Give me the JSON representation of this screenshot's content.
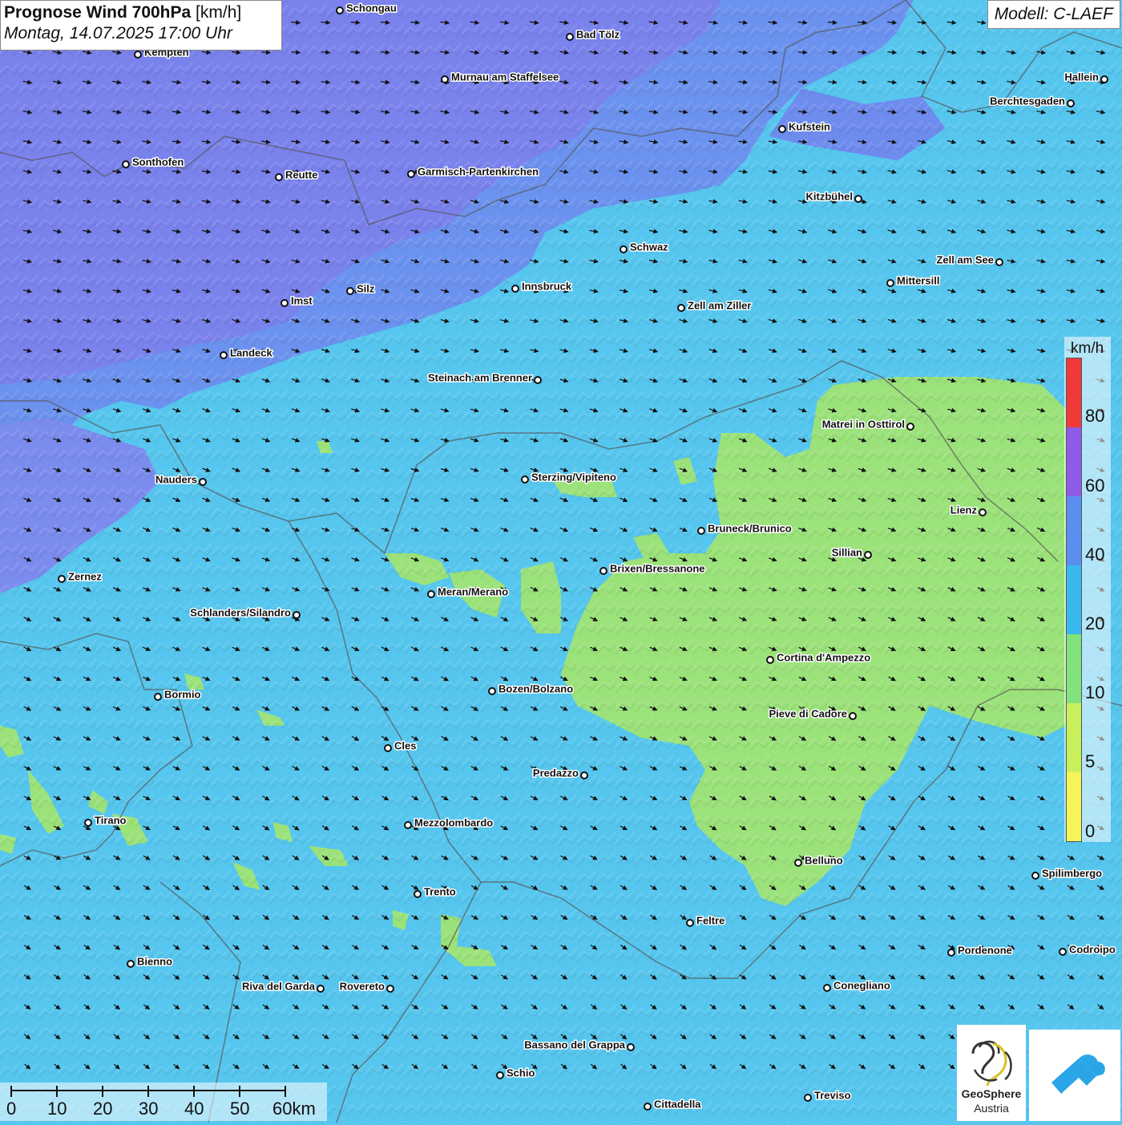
{
  "title": {
    "bold": "Prognose Wind 700hPa",
    "unit": "[km/h]",
    "datetime": "Montag, 14.07.2025 17:00 Uhr"
  },
  "model": "Modell: C-LAEF",
  "legend": {
    "unit": "km/h",
    "ticks": [
      "80",
      "60",
      "40",
      "20",
      "10",
      "5",
      "0"
    ],
    "colors": [
      "#f03a3a",
      "#8e5ce8",
      "#5a8ff0",
      "#38b8ee",
      "#82e27c",
      "#c8f05a",
      "#f5f55a"
    ]
  },
  "scalebar": {
    "labels": [
      "0",
      "10",
      "20",
      "30",
      "40",
      "50",
      "60km"
    ]
  },
  "logos": {
    "geosphere_line1": "GeoSphere",
    "geosphere_line2": "Austria"
  },
  "colors": {
    "speed_20_40": "#5a8ff0",
    "speed_40_60": "#7a82ec",
    "speed_10_20": "#56c6ee",
    "speed_5_10": "#9be27a"
  },
  "cities": [
    {
      "name": "Schongau"
    },
    {
      "name": "Bad Tölz"
    },
    {
      "name": "Kempten"
    },
    {
      "name": "Murnau am Staffelsee"
    },
    {
      "name": "Hallein"
    },
    {
      "name": "Berchtesgaden"
    },
    {
      "name": "Kufstein"
    },
    {
      "name": "Sonthofen"
    },
    {
      "name": "Reutte"
    },
    {
      "name": "Garmisch-Partenkirchen"
    },
    {
      "name": "Kitzbühel"
    },
    {
      "name": "Schwaz"
    },
    {
      "name": "Zell am See"
    },
    {
      "name": "Mittersill"
    },
    {
      "name": "Innsbruck"
    },
    {
      "name": "Silz"
    },
    {
      "name": "Imst"
    },
    {
      "name": "Zell am Ziller"
    },
    {
      "name": "Landeck"
    },
    {
      "name": "Steinach am Brenner"
    },
    {
      "name": "Matrei in Osttirol"
    },
    {
      "name": "Nauders"
    },
    {
      "name": "Sterzing/Vipiteno"
    },
    {
      "name": "Lienz"
    },
    {
      "name": "Bruneck/Brunico"
    },
    {
      "name": "Sillian"
    },
    {
      "name": "Brixen/Bressanone"
    },
    {
      "name": "Zernez"
    },
    {
      "name": "Meran/Merano"
    },
    {
      "name": "Schlanders/Silandro"
    },
    {
      "name": "Cortina d'Ampezzo"
    },
    {
      "name": "Bormio"
    },
    {
      "name": "Bozen/Bolzano"
    },
    {
      "name": "Pieve di Cadore"
    },
    {
      "name": "Cles"
    },
    {
      "name": "Predazzo"
    },
    {
      "name": "Tirano"
    },
    {
      "name": "Mezzolombardo"
    },
    {
      "name": "Belluno"
    },
    {
      "name": "Spilimbergo"
    },
    {
      "name": "Trento"
    },
    {
      "name": "Feltre"
    },
    {
      "name": "Pordenone"
    },
    {
      "name": "Codroipo"
    },
    {
      "name": "Bienno"
    },
    {
      "name": "Riva del Garda"
    },
    {
      "name": "Rovereto"
    },
    {
      "name": "Conegliano"
    },
    {
      "name": "Bassano del Grappa"
    },
    {
      "name": "Schio"
    },
    {
      "name": "Treviso"
    },
    {
      "name": "Cittadella"
    }
  ]
}
